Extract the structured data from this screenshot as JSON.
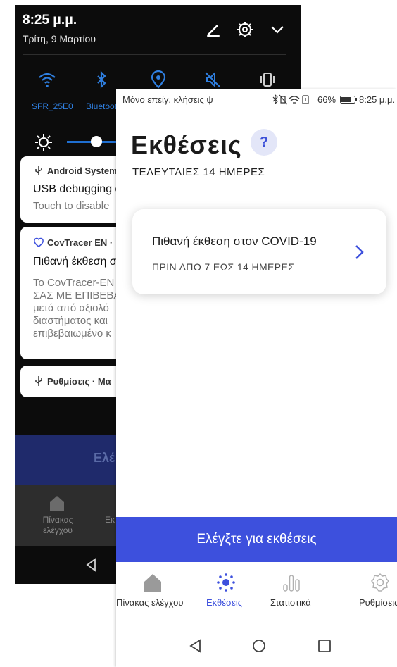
{
  "colors": {
    "accent": "#3d50dd",
    "help_bg": "#e3e6f8",
    "shade_bg": "#0c0c0c",
    "quick_setting_blue": "#2f7fe0"
  },
  "shade": {
    "time": "8:25 μ.μ.",
    "date": "Τρίτη, 9 Μαρτίου",
    "top_icons": [
      "edit-icon",
      "gear-icon",
      "chevron-down-icon"
    ],
    "quick_settings": [
      {
        "icon": "wifi-icon",
        "label": "SFR_25E0"
      },
      {
        "icon": "bluetooth-icon",
        "label": "Bluetoot"
      },
      {
        "icon": "location-icon",
        "label": ""
      },
      {
        "icon": "mute-icon",
        "label": ""
      },
      {
        "icon": "vibrate-icon",
        "label": ""
      }
    ],
    "notifications": [
      {
        "app": "Android System",
        "title": "USB debugging c",
        "subtitle": "Touch to disable"
      },
      {
        "app": "CovTracer EN ·",
        "title": "Πιθανή έκθεση σ",
        "body": [
          "Το CovTracer-EN",
          "ΣΑΣ ΜΕ ΕΠΙΒΕΒΑ",
          "μετά από αξιολό",
          "διαστήματος και",
          "επιβεβαιωμένο κ"
        ]
      },
      {
        "app": "Ρυθμίσεις · Μα"
      }
    ],
    "button_label": "Ελέ",
    "nav": {
      "home_label": "Πίνακας ελέγχου",
      "second_label": "Εκ"
    }
  },
  "status_bar": {
    "left": "Μόνο επείγ. κλήσεις ψ",
    "battery": "66%",
    "time": "8:25 μ.μ."
  },
  "page": {
    "title": "Εκθέσεις",
    "help": "?",
    "subtitle": "ΤΕΛΕΥΤΑΙΕΣ 14 ΗΜΕΡΕΣ"
  },
  "exposure_card": {
    "title": "Πιθανή έκθεση στον COVID-19",
    "subtitle": "ΠΡΙΝ ΑΠΟ 7 ΕΩΣ 14 ΗΜΕΡΕΣ"
  },
  "cta": {
    "label": "Ελέγξτε για εκθέσεις"
  },
  "tabs": [
    {
      "label": "Πίνακας ελέγχου",
      "icon": "home-icon",
      "active": false
    },
    {
      "label": "Εκθέσεις",
      "icon": "exposures-icon",
      "active": true
    },
    {
      "label": "Στατιστικά",
      "icon": "stats-icon",
      "active": false
    },
    {
      "label": "Ρυθμίσεις",
      "icon": "settings-icon",
      "active": false
    }
  ]
}
